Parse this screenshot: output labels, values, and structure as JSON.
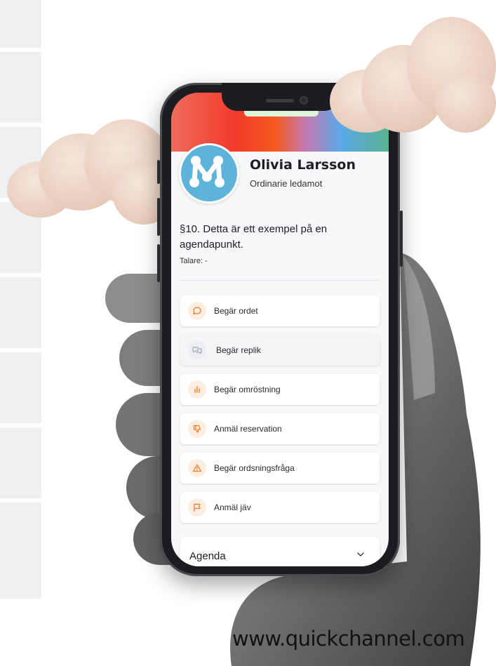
{
  "profile": {
    "name": "Olivia Larsson",
    "role": "Ordinarie ledamot"
  },
  "agenda_item": {
    "title": "§10. Detta är ett exempel på en agendapunkt.",
    "speaker": "Talare: -"
  },
  "actions": [
    {
      "label": "Begär ordet",
      "icon": "speech-bubble-icon",
      "enabled": true
    },
    {
      "label": "Begär replik",
      "icon": "chat-bubbles-icon",
      "enabled": false
    },
    {
      "label": "Begär omröstning",
      "icon": "bar-chart-icon",
      "enabled": true
    },
    {
      "label": "Anmäl reservation",
      "icon": "thumbs-down-icon",
      "enabled": true
    },
    {
      "label": "Begär ordsningsfråga",
      "icon": "warning-icon",
      "enabled": true
    },
    {
      "label": "Anmäl jäv",
      "icon": "flag-icon",
      "enabled": true
    }
  ],
  "agenda": {
    "label": "Agenda",
    "icon": "chevron-down-icon"
  },
  "footer": {
    "url": "www.quickchannel.com"
  },
  "colors": {
    "accent": "#f07a1e",
    "avatar": "#5db3d9"
  }
}
